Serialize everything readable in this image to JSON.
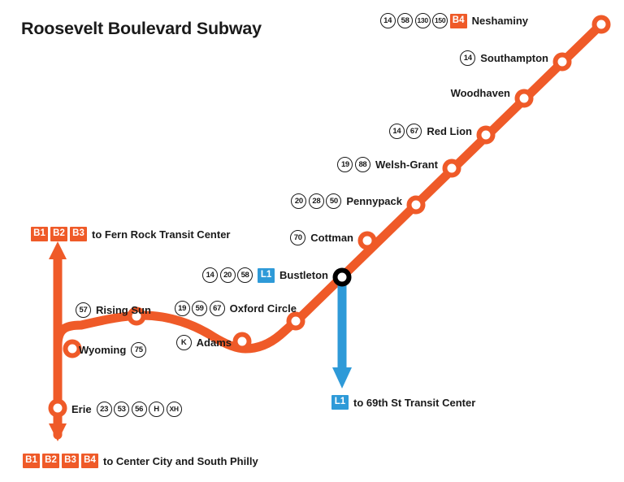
{
  "title": "Roosevelt Boulevard Subway",
  "colors": {
    "orange_line": "#ef5a28",
    "blue_line": "#2e9ad8",
    "station_stroke": "#ef5a28",
    "interchange_stroke": "#000000",
    "text": "#1a1a1a",
    "background": "#ffffff"
  },
  "stations": [
    {
      "name": "Neshaminy",
      "badges": [
        "14",
        "58",
        "130",
        "150"
      ],
      "route_badges": [
        "B4"
      ],
      "type": "terminus"
    },
    {
      "name": "Southampton",
      "badges": [
        "14"
      ],
      "route_badges": [],
      "type": "stop"
    },
    {
      "name": "Woodhaven",
      "badges": [],
      "route_badges": [],
      "type": "stop"
    },
    {
      "name": "Red Lion",
      "badges": [
        "14",
        "67"
      ],
      "route_badges": [],
      "type": "stop"
    },
    {
      "name": "Welsh-Grant",
      "badges": [
        "19",
        "88"
      ],
      "route_badges": [],
      "type": "stop"
    },
    {
      "name": "Pennypack",
      "badges": [
        "20",
        "28",
        "50"
      ],
      "route_badges": [],
      "type": "stop"
    },
    {
      "name": "Cottman",
      "badges": [
        "70"
      ],
      "route_badges": [],
      "type": "stop"
    },
    {
      "name": "Bustleton",
      "badges": [
        "14",
        "20",
        "58"
      ],
      "route_badges": [
        "L1"
      ],
      "type": "interchange"
    },
    {
      "name": "Oxford Circle",
      "badges": [
        "19",
        "59",
        "67"
      ],
      "route_badges": [],
      "type": "stop"
    },
    {
      "name": "Adams",
      "badges": [
        "K"
      ],
      "route_badges": [],
      "type": "stop"
    },
    {
      "name": "Rising Sun",
      "badges": [
        "57"
      ],
      "route_badges": [],
      "type": "stop"
    },
    {
      "name": "Wyoming",
      "badges": [
        "75"
      ],
      "route_badges": [],
      "type": "stop"
    },
    {
      "name": "Erie",
      "badges": [
        "23",
        "53",
        "56",
        "H",
        "XH"
      ],
      "route_badges": [],
      "type": "stop"
    }
  ],
  "destinations": {
    "fern_rock": {
      "route_badges": [
        "B1",
        "B2",
        "B3"
      ],
      "text": "to Fern Rock Transit Center"
    },
    "center_city": {
      "route_badges": [
        "B1",
        "B2",
        "B3",
        "B4"
      ],
      "text": "to Center City and South Philly"
    },
    "sixty_ninth": {
      "route_badges": [
        "L1"
      ],
      "text": "to 69th St Transit Center"
    }
  }
}
